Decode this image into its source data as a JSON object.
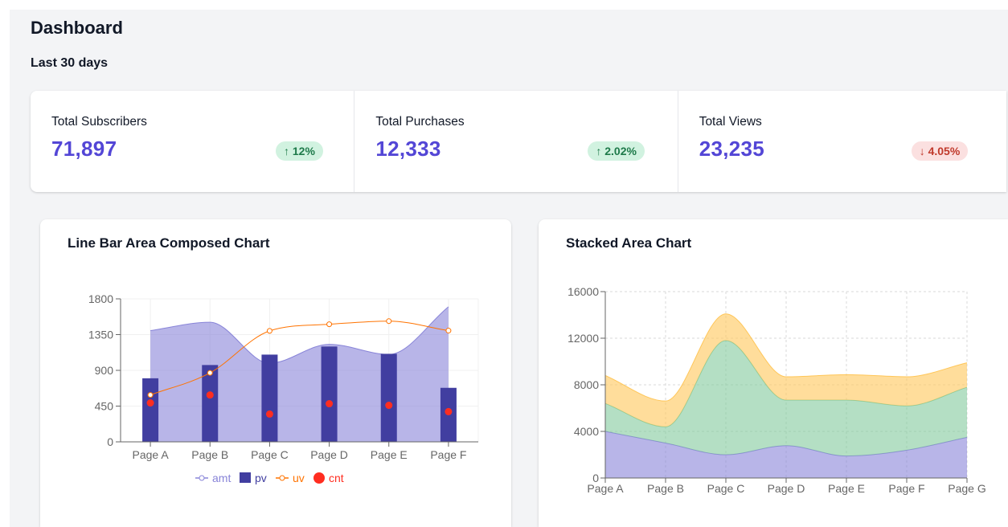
{
  "header": {
    "title": "Dashboard",
    "subtitle": "Last 30 days"
  },
  "stats": [
    {
      "label": "Total Subscribers",
      "value": "71,897",
      "change": "12%",
      "direction": "up",
      "icon": "arrow-up-icon"
    },
    {
      "label": "Total Purchases",
      "value": "12,333",
      "change": "2.02%",
      "direction": "up",
      "icon": "arrow-up-icon"
    },
    {
      "label": "Total Views",
      "value": "23,235",
      "change": "4.05%",
      "direction": "down",
      "icon": "arrow-down-icon"
    }
  ],
  "colors": {
    "accent": "#5346d6",
    "amt": "#8884d8",
    "pv": "#413ea0",
    "uv": "#ff7300",
    "cnt": "#ff2d20",
    "stack_a": "#8884d8",
    "stack_b": "#82ca9d",
    "stack_c": "#ffc658"
  },
  "chart_data": [
    {
      "type": "composed",
      "title": "Line Bar Area Composed Chart",
      "categories": [
        "Page A",
        "Page B",
        "Page C",
        "Page D",
        "Page E",
        "Page F"
      ],
      "ylim": [
        0,
        1800
      ],
      "yticks": [
        0,
        450,
        900,
        1350,
        1800
      ],
      "grid": true,
      "legend_position": "bottom",
      "series": [
        {
          "name": "amt",
          "kind": "area",
          "values": [
            1400,
            1506,
            989,
            1228,
            1100,
            1700
          ]
        },
        {
          "name": "pv",
          "kind": "bar",
          "values": [
            800,
            967,
            1098,
            1200,
            1108,
            680
          ]
        },
        {
          "name": "uv",
          "kind": "line",
          "values": [
            590,
            868,
            1397,
            1480,
            1520,
            1400
          ]
        },
        {
          "name": "cnt",
          "kind": "scatter",
          "values": [
            490,
            590,
            350,
            480,
            460,
            380
          ]
        }
      ]
    },
    {
      "type": "area",
      "stacked": true,
      "title": "Stacked Area Chart",
      "categories": [
        "Page A",
        "Page B",
        "Page C",
        "Page D",
        "Page E",
        "Page F",
        "Page G"
      ],
      "ylim": [
        0,
        16000
      ],
      "yticks": [
        0,
        4000,
        8000,
        12000,
        16000
      ],
      "grid": true,
      "series": [
        {
          "values": [
            4000,
            3000,
            2000,
            2780,
            1890,
            2390,
            3490
          ]
        },
        {
          "values": [
            2400,
            1398,
            9800,
            3908,
            4800,
            3800,
            4300
          ]
        },
        {
          "values": [
            2400,
            2210,
            2290,
            2000,
            2181,
            2500,
            2100
          ]
        }
      ]
    }
  ]
}
